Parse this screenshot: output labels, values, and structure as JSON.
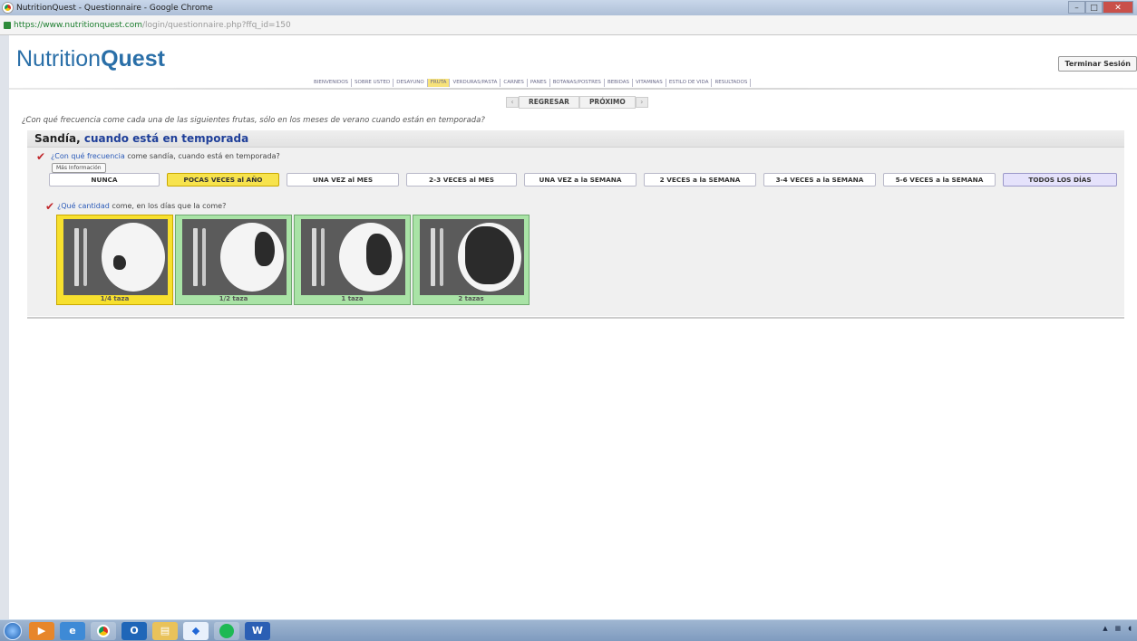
{
  "window": {
    "title": "NutritionQuest - Questionnaire - Google Chrome"
  },
  "address_bar": {
    "host": "https://www.nutritionquest.com",
    "path": "/login/questionnaire.php?ffq_id=150"
  },
  "header": {
    "logo_regular": "Nutrition",
    "logo_bold": "Quest",
    "logout_label": "Terminar Sesión"
  },
  "nav_tabs": [
    {
      "label": "BIENVENIDOS",
      "active": false
    },
    {
      "label": "SOBRE USTED",
      "active": false
    },
    {
      "label": "DESAYUNO",
      "active": false
    },
    {
      "label": "FRUTA",
      "active": true
    },
    {
      "label": "VERDURAS/PASTA",
      "active": false
    },
    {
      "label": "CARNES",
      "active": false
    },
    {
      "label": "PANES",
      "active": false
    },
    {
      "label": "BOTANAS/POSTRES",
      "active": false
    },
    {
      "label": "BEBIDAS",
      "active": false
    },
    {
      "label": "VITAMINAS",
      "active": false
    },
    {
      "label": "ESTILO DE VIDA",
      "active": false
    },
    {
      "label": "RESULTADOS",
      "active": false
    }
  ],
  "pager": {
    "back_label": "REGRESAR",
    "next_label": "PRÓXIMO"
  },
  "instruction": "¿Con qué frecuencia come cada una de las siguientes frutas, sólo en los meses de verano cuando están en temporada?",
  "food_item": {
    "name": "Sandía,",
    "qualifier": "cuando está en temporada"
  },
  "question1": {
    "prefix": "¿Con qué frecuencia",
    "rest": "come sandía, cuando está en temporada?",
    "more_info_label": "Más Información",
    "options": [
      {
        "label": "NUNCA",
        "selected": false
      },
      {
        "label": "POCAS VECES al AÑO",
        "selected": true
      },
      {
        "label": "UNA VEZ al MES",
        "selected": false
      },
      {
        "label": "2-3 VECES al MES",
        "selected": false
      },
      {
        "label": "UNA VEZ a la SEMANA",
        "selected": false
      },
      {
        "label": "2 VECES a la SEMANA",
        "selected": false
      },
      {
        "label": "3-4 VECES a la SEMANA",
        "selected": false
      },
      {
        "label": "5-6 VECES a la SEMANA",
        "selected": false
      },
      {
        "label": "TODOS LOS DÍAS",
        "selected": false
      }
    ]
  },
  "question2": {
    "prefix": "¿Qué cantidad",
    "rest": "come, en los días que la come?",
    "portions": [
      {
        "label": "1/4 taza",
        "selected": true
      },
      {
        "label": "1/2 taza",
        "selected": false
      },
      {
        "label": "1 taza",
        "selected": false
      },
      {
        "label": "2 tazas",
        "selected": false
      }
    ]
  },
  "taskbar": {
    "apps": [
      "start-icon",
      "media-player-icon",
      "ie-icon",
      "chrome-icon",
      "outlook-icon",
      "explorer-icon",
      "dropbox-icon",
      "spotify-icon",
      "word-icon"
    ]
  },
  "colors": {
    "selected": "#f7e34d",
    "portion_bg": "#a9e3a6",
    "link": "#2a5ab8",
    "logo": "#2a6fa8",
    "check": "#c0262a"
  }
}
